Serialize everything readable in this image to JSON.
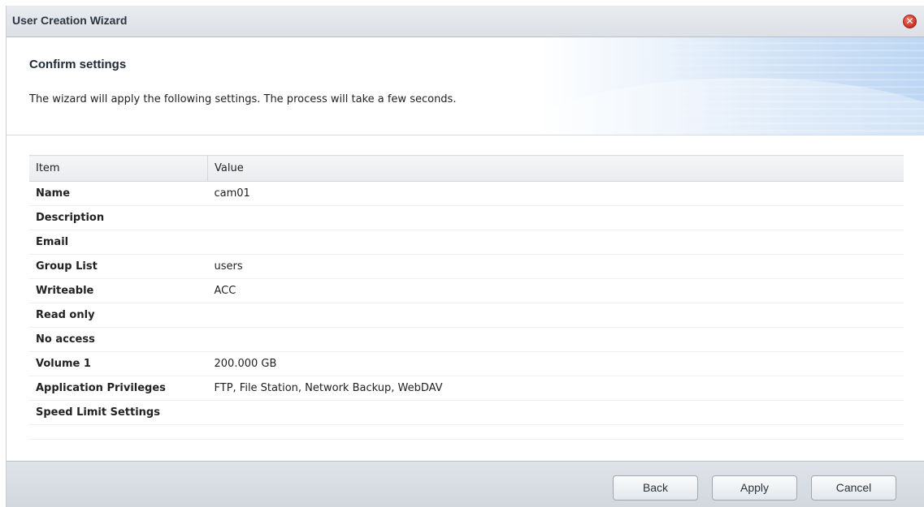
{
  "window": {
    "title": "User Creation Wizard"
  },
  "header": {
    "step_title": "Confirm settings",
    "description": "The wizard will apply the following settings. The process will take a few seconds."
  },
  "table": {
    "columns": [
      "Item",
      "Value"
    ],
    "rows": [
      {
        "item": "Name",
        "value": "cam01"
      },
      {
        "item": "Description",
        "value": ""
      },
      {
        "item": "Email",
        "value": ""
      },
      {
        "item": "Group List",
        "value": "users"
      },
      {
        "item": "Writeable",
        "value": "ACC"
      },
      {
        "item": "Read only",
        "value": ""
      },
      {
        "item": "No access",
        "value": ""
      },
      {
        "item": "Volume 1",
        "value": "200.000 GB"
      },
      {
        "item": "Application Privileges",
        "value": "FTP, File Station, Network Backup, WebDAV"
      },
      {
        "item": "Speed Limit Settings",
        "value": ""
      }
    ]
  },
  "footer": {
    "back_label": "Back",
    "apply_label": "Apply",
    "cancel_label": "Cancel"
  },
  "colors": {
    "close_button": "#cc2f23",
    "footer_bg": "#d3d8de",
    "header_accent": "#bcd6f3"
  }
}
